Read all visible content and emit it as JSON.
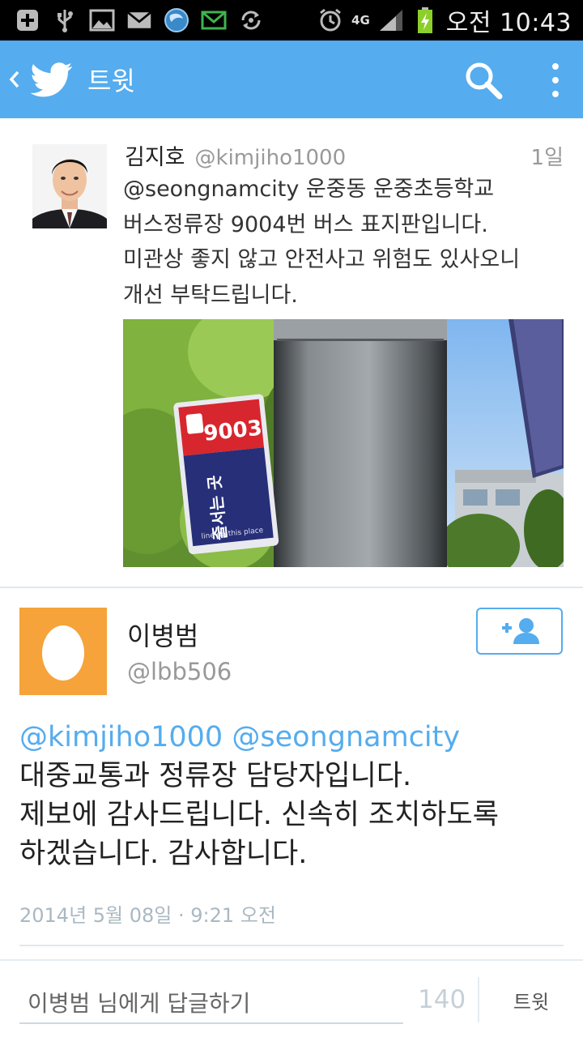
{
  "status_bar": {
    "icons": [
      "add-notification-icon",
      "usb-icon",
      "image-icon",
      "mail-icon",
      "browser-icon",
      "email-icon",
      "sync-icon",
      "alarm-icon",
      "network-4g-icon",
      "signal-icon",
      "battery-charging-icon"
    ],
    "network": "4G",
    "time": "오전 10:43"
  },
  "action_bar": {
    "back_icon": "back-chevron-icon",
    "logo_icon": "twitter-bird-icon",
    "title": "트윗",
    "search_icon": "search-icon",
    "more_icon": "more-vertical-icon",
    "background_color": "#55acee"
  },
  "reply_to_tweet": {
    "name": "김지호",
    "handle": "@kimjiho1000",
    "time": "1일",
    "text": "@seongnamcity 운중동 운중초등학교\n버스정류장 9004번 버스 표지판입니다.\n미관상 좋지 않고 안전사고 위험도 있사오니\n개선 부탁드립니다.",
    "image": {
      "sign_number": "9003",
      "sign_text": "줄서는 곳",
      "sign_subtext": "line up this place"
    }
  },
  "tweet": {
    "name": "이병범",
    "handle": "@lbb506",
    "follow_icon": "add-user-icon",
    "mentions": [
      "@kimjiho1000",
      "@seongnamcity"
    ],
    "lines": [
      "대중교통과 정류장 담당자입니다.",
      "제보에 감사드립니다. 신속히 조치하도록",
      "하겠습니다. 감사합니다."
    ],
    "date": "2014년 5월 08일 · 9:21 오전"
  },
  "composer": {
    "placeholder": "이병범 님에게 답글하기",
    "char_count": "140",
    "submit_label": "트윗"
  }
}
